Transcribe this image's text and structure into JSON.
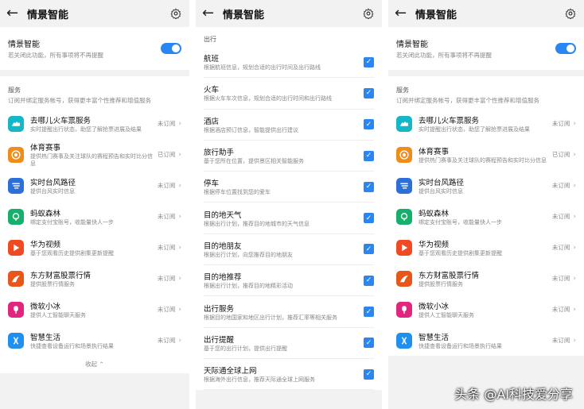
{
  "screen1": {
    "title": "情景智能",
    "toggle": {
      "title": "情景智能",
      "sub": "若关闭此功能，所有事项将不再提醒"
    },
    "section": {
      "title": "服务",
      "sub": "订阅并绑定服务帐号，获得更丰富个性推荐和增值服务"
    },
    "services": [
      {
        "name": "去哪儿火车票服务",
        "desc": "实时提醒出行状态，助您了解抢票进展及结果",
        "status": "未订阅",
        "color": "#13b7c8",
        "icon": "camel-icon"
      },
      {
        "name": "体育赛事",
        "desc": "提供热门赛事及关注球队的赛程预告和实时比分信息",
        "status": "已订阅",
        "color": "#f08c1a",
        "icon": "ball-icon"
      },
      {
        "name": "实时台风路径",
        "desc": "提供台风实时信息",
        "status": "未订阅",
        "color": "#2c6fd8",
        "icon": "typhoon-icon"
      },
      {
        "name": "蚂蚁森林",
        "desc": "绑定支付宝账号，收能量快人一步",
        "status": "未订阅",
        "color": "#17b06b",
        "icon": "tree-icon"
      },
      {
        "name": "华为视频",
        "desc": "基于您观看历史提供剧集更新提醒",
        "status": "未订阅",
        "color": "#f04a23",
        "icon": "play-icon"
      },
      {
        "name": "东方财富股票行情",
        "desc": "提供股票行情服务",
        "status": "未订阅",
        "color": "#e8571a",
        "icon": "wing-icon"
      },
      {
        "name": "微软小冰",
        "desc": "提供人工智能聊天服务",
        "status": "未订阅",
        "color": "#e2257e",
        "icon": "popsicle-icon"
      },
      {
        "name": "智慧生活",
        "desc": "快捷查看设备运行和场景执行结果",
        "status": "未订阅",
        "color": "#1f8ff0",
        "icon": "smart-life-icon"
      }
    ],
    "collapse": "收起"
  },
  "screen2": {
    "title": "情景智能",
    "group": "出行",
    "items": [
      {
        "name": "航班",
        "desc": "根据航班信息，规划合适的出行时间及出行路线"
      },
      {
        "name": "火车",
        "desc": "根据火车车次信息，规划合适的出行时间和出行路线"
      },
      {
        "name": "酒店",
        "desc": "根据酒店预订信息，智能提供出行建议"
      },
      {
        "name": "旅行助手",
        "desc": "基于您所在位置，提供景区相关智能服务"
      },
      {
        "name": "停车",
        "desc": "根据停车位置找到您的爱车"
      },
      {
        "name": "目的地天气",
        "desc": "根据出行计划，推荐目的地城市的天气信息"
      },
      {
        "name": "目的地朋友",
        "desc": "根据出行计划，向您推荐目的地朋友"
      },
      {
        "name": "目的地推荐",
        "desc": "根据出行计划，推荐目的地精彩活动"
      },
      {
        "name": "出行服务",
        "desc": "根据目的地国家和地区出行计划，推荐汇率等相关服务"
      },
      {
        "name": "出行提醒",
        "desc": "基于您的出行计划，提供出行提醒"
      },
      {
        "name": "天际通全球上网",
        "desc": "根据海外出行信息，推荐天际通全球上网服务"
      }
    ]
  },
  "screen3": {
    "title": "情景智能",
    "toggle": {
      "title": "情景智能",
      "sub": "若关闭此功能，所有事项将不再提醒"
    },
    "section": {
      "title": "服务",
      "sub": "订阅并绑定服务帐号，获得更丰富个性推荐和增值服务"
    },
    "services": [
      {
        "name": "去哪儿火车票服务",
        "desc": "实时提醒出行状态，助您了解抢票进展及结果",
        "status": "未订阅",
        "color": "#13b7c8",
        "icon": "camel-icon"
      },
      {
        "name": "体育赛事",
        "desc": "提供热门赛事及关注球队的赛程预告和实时比分信息",
        "status": "已订阅",
        "color": "#f08c1a",
        "icon": "ball-icon"
      },
      {
        "name": "实时台风路径",
        "desc": "提供台风实时信息",
        "status": "未订阅",
        "color": "#2c6fd8",
        "icon": "typhoon-icon"
      },
      {
        "name": "蚂蚁森林",
        "desc": "绑定支付宝账号，收能量快人一步",
        "status": "未订阅",
        "color": "#17b06b",
        "icon": "tree-icon"
      },
      {
        "name": "华为视频",
        "desc": "基于您观看历史提供剧集更新提醒",
        "status": "未订阅",
        "color": "#f04a23",
        "icon": "play-icon"
      },
      {
        "name": "东方财富股票行情",
        "desc": "提供股票行情服务",
        "status": "未订阅",
        "color": "#e8571a",
        "icon": "wing-icon"
      },
      {
        "name": "微软小冰",
        "desc": "提供人工智能聊天服务",
        "status": "未订阅",
        "color": "#e2257e",
        "icon": "popsicle-icon"
      },
      {
        "name": "智慧生活",
        "desc": "快捷查看设备运行和场景执行结果",
        "status": "未订阅",
        "color": "#1f8ff0",
        "icon": "smart-life-icon"
      }
    ]
  },
  "watermark": "头条 @AI科技爱分享"
}
